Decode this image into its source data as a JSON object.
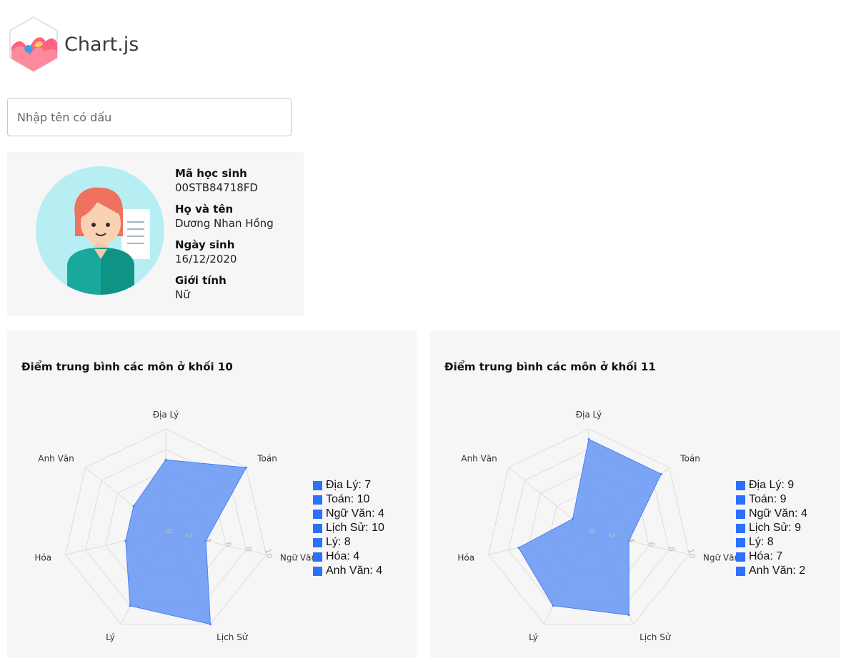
{
  "brand": {
    "name": "Chart.js"
  },
  "search": {
    "placeholder": "Nhập tên có dấu",
    "value": ""
  },
  "student": {
    "id_label": "Mã học sinh",
    "id": "00STB84718FD",
    "name_label": "Họ và tên",
    "name": "Dương Nhan Hồng",
    "dob_label": "Ngày sinh",
    "dob": "16/12/2020",
    "gender_label": "Giới tính",
    "gender": "Nữ"
  },
  "colors": {
    "fill": "#6f9bf5",
    "stroke": "#4b82f2",
    "legend": "#2d6fff",
    "grid": "#dddddd",
    "panel": "#f6f6f6"
  },
  "chart_data": [
    {
      "type": "radar",
      "title": "Điểm trung bình các môn ở khối 10",
      "categories": [
        "Địa Lý",
        "Toán",
        "Ngữ Văn",
        "Lịch Sử",
        "Lý",
        "Hóa",
        "Anh Văn"
      ],
      "values": [
        7,
        10,
        4,
        10,
        8,
        4,
        4
      ],
      "legend": [
        "Địa Lý: 7",
        "Toán: 10",
        "Ngữ Văn: 4",
        "Lịch Sử: 10",
        "Lý: 8",
        "Hóa: 4",
        "Anh Văn: 4"
      ],
      "rlim": [
        0,
        10
      ],
      "ticks": [
        "0",
        "2",
        "4",
        "6",
        "8",
        "10"
      ],
      "legend_position": "right"
    },
    {
      "type": "radar",
      "title": "Điểm trung bình các môn ở khối 11",
      "categories": [
        "Địa Lý",
        "Toán",
        "Ngữ Văn",
        "Lịch Sử",
        "Lý",
        "Hóa",
        "Anh Văn"
      ],
      "values": [
        9,
        9,
        4,
        9,
        8,
        7,
        2
      ],
      "legend": [
        "Địa Lý: 9",
        "Toán: 9",
        "Ngữ Văn: 4",
        "Lịch Sử: 9",
        "Lý: 8",
        "Hóa: 7",
        "Anh Văn: 2"
      ],
      "rlim": [
        0,
        10
      ],
      "ticks": [
        "0",
        "2",
        "4",
        "6",
        "8",
        "10"
      ],
      "legend_position": "right"
    }
  ]
}
